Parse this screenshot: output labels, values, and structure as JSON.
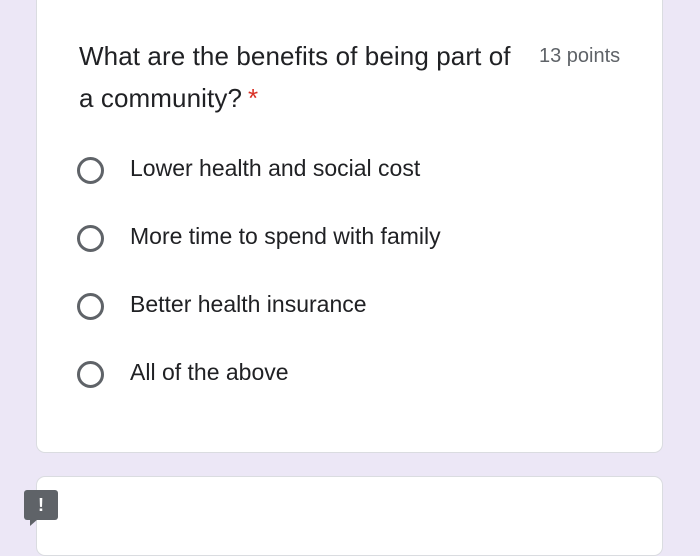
{
  "question": {
    "title": "What are the benefits of being part of a community?",
    "required_mark": "*",
    "points": "13 points",
    "options": [
      {
        "label": "Lower health and social cost"
      },
      {
        "label": "More time to spend with family"
      },
      {
        "label": "Better health insurance"
      },
      {
        "label": "All of the above"
      }
    ]
  },
  "feedback": {
    "icon": "feedback-exclamation-icon",
    "glyph": "!"
  },
  "colors": {
    "background": "#ece7f6",
    "card": "#ffffff",
    "required": "#d93025",
    "text": "#202124",
    "secondary_text": "#5f6368"
  }
}
